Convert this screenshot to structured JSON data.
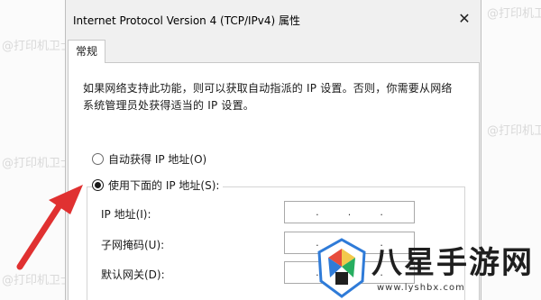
{
  "window": {
    "title": "Internet Protocol Version 4 (TCP/IPv4) 属性",
    "close_glyph": "✕"
  },
  "tabs": [
    {
      "label": "常规"
    }
  ],
  "description": "如果网络支持此功能，则可以获取自动指派的 IP 设置。否则，你需要从网络系统管理员处获得适当的 IP 设置。",
  "radio_auto": {
    "label": "自动获得 IP 地址(O)",
    "checked": false
  },
  "radio_manual": {
    "label": "使用下面的 IP 地址(S):",
    "checked": true
  },
  "fields": {
    "ip": {
      "label": "IP 地址(I):",
      "value": ". . ."
    },
    "subnet": {
      "label": "子网掩码(U):",
      "value": ". . ."
    },
    "gateway": {
      "label": "默认网关(D):",
      "value": ". . ."
    }
  },
  "watermark": "@打印机卫士",
  "brand": {
    "name": "八星手游网",
    "url": "www.lyshbx.com"
  },
  "colors": {
    "arrow": "#e03131",
    "brand_accent": "#2f7bd8"
  }
}
